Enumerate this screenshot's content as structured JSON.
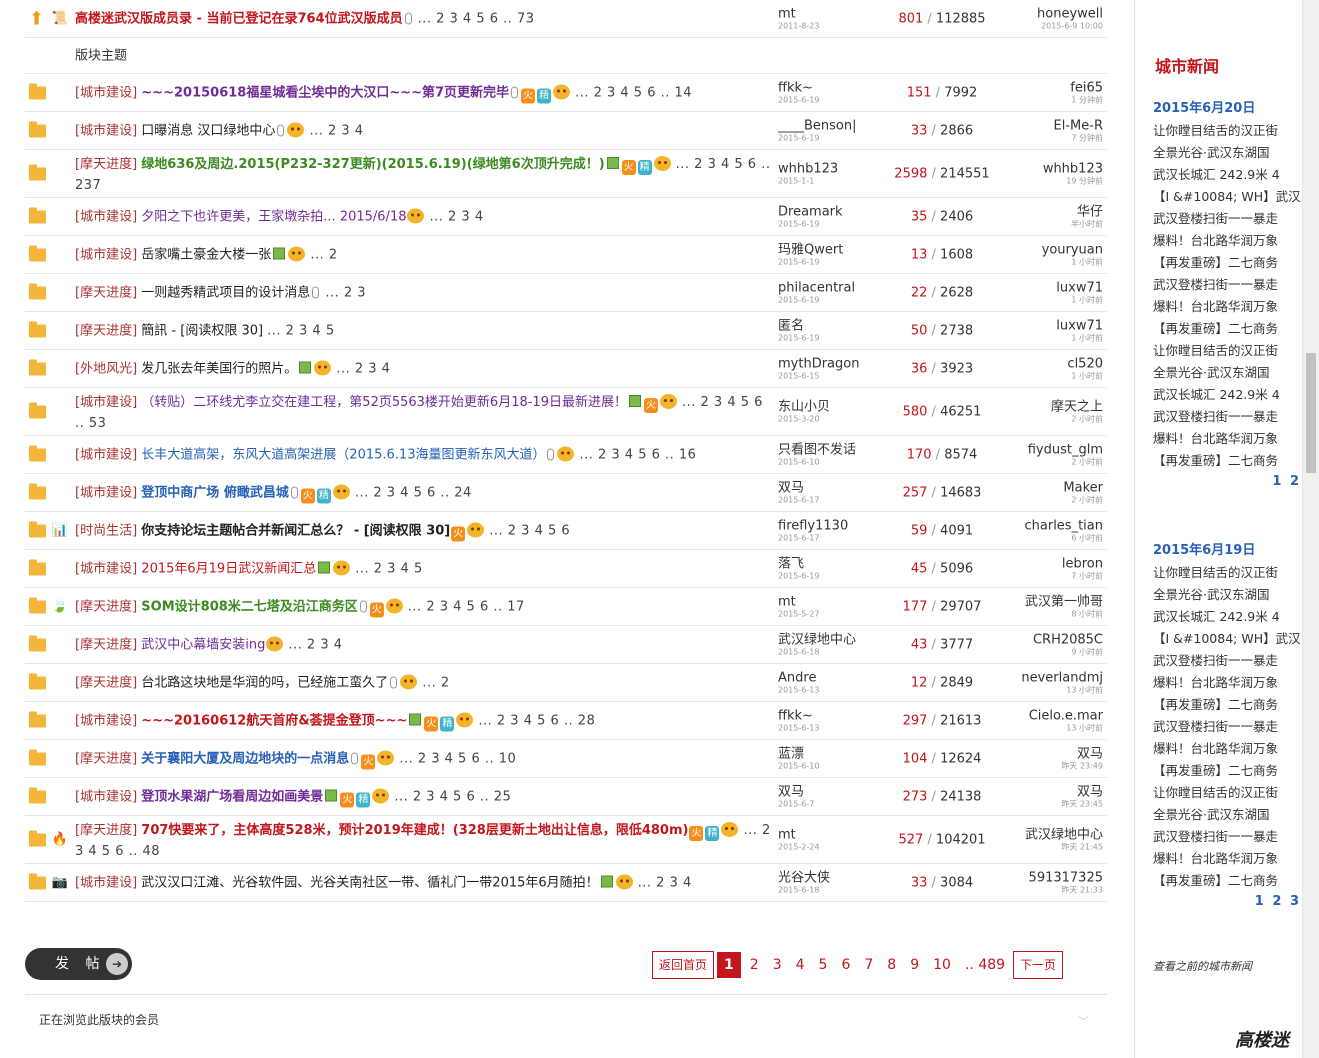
{
  "colors": {
    "accent_red": "#c3161c",
    "link_blue": "#2761b7",
    "folder": "#f5b53b"
  },
  "section_header": "版块主题",
  "threads": [
    {
      "icon2": "note",
      "category": "",
      "title": "高楼迷武汉版成员录 - 当前已登记在录764位武汉版成员",
      "tcls": "t-red b",
      "attach": true,
      "img": false,
      "fire": false,
      "jing": false,
      "smile": false,
      "pages": "... 2 3 4 5 6 .. 73",
      "author": "mt",
      "adate": "2011-8-23",
      "replies": "801",
      "views": "112885",
      "last": "honeywell",
      "ldate": "2015-6-9 10:00",
      "two": false
    },
    {
      "icon2": "",
      "category": "[城市建设]",
      "title": "~~~20150618福星城看尘埃中的大汉口~~~第7页更新完毕",
      "tcls": "t-purple b",
      "attach": true,
      "img": false,
      "fire": true,
      "jing": true,
      "smile": true,
      "pages": "... 2 3 4 5 6 .. 14",
      "author": "ffkk~",
      "adate": "2015-6-19",
      "replies": "151",
      "views": "7992",
      "last": "fei65",
      "ldate": "1 分钟前",
      "two": false
    },
    {
      "icon2": "",
      "category": "[城市建设]",
      "title": "口曝消息 汉口绿地中心",
      "tcls": "t-dark",
      "attach": true,
      "img": false,
      "fire": false,
      "jing": false,
      "smile": true,
      "pages": "... 2 3 4",
      "author": "____Benson|",
      "adate": "2015-6-19",
      "replies": "33",
      "views": "2866",
      "last": "El-Me-R",
      "ldate": "7 分钟前",
      "two": false
    },
    {
      "icon2": "",
      "category": "[摩天进度]",
      "title": "绿地636及周边.2015(P232-327更新)(2015.6.19)(绿地第6次顶升完成！)",
      "tcls": "t-green b",
      "attach": false,
      "img": true,
      "fire": true,
      "jing": true,
      "smile": true,
      "pages": "... 2 3 4 5 6 .. 237",
      "author": "whhb123",
      "adate": "2015-1-1",
      "replies": "2598",
      "views": "214551",
      "last": "whhb123",
      "ldate": "19 分钟前",
      "two": true
    },
    {
      "icon2": "",
      "category": "[城市建设]",
      "title": "夕阳之下也许更美，王家墩杂拍... 2015/6/18",
      "tcls": "t-purple",
      "attach": false,
      "img": false,
      "fire": false,
      "jing": false,
      "smile": true,
      "pages": "... 2 3 4",
      "author": "Dreamark",
      "adate": "2015-6-19",
      "replies": "35",
      "views": "2406",
      "last": "华仔",
      "ldate": "半小时前",
      "two": false
    },
    {
      "icon2": "",
      "category": "[城市建设]",
      "title": "岳家嘴土豪金大楼一张",
      "tcls": "t-dark",
      "attach": false,
      "img": true,
      "fire": false,
      "jing": false,
      "smile": true,
      "pages": "... 2",
      "author": "玛雅Qwert",
      "adate": "2015-6-19",
      "replies": "13",
      "views": "1608",
      "last": "youryuan",
      "ldate": "1 小时前",
      "two": false
    },
    {
      "icon2": "",
      "category": "[摩天进度]",
      "title": "一则越秀精武项目的设计消息",
      "tcls": "t-dark",
      "attach": true,
      "img": false,
      "fire": false,
      "jing": false,
      "smile": false,
      "pages": "... 2 3",
      "author": "philacentral",
      "adate": "2015-6-19",
      "replies": "22",
      "views": "2628",
      "last": "luxw71",
      "ldate": "1 小时前",
      "two": false
    },
    {
      "icon2": "",
      "category": "[摩天进度]",
      "title": "簡訊 - [阅读权限 30]",
      "tcls": "t-dark",
      "attach": false,
      "img": false,
      "fire": false,
      "jing": false,
      "smile": false,
      "pages": "... 2 3 4 5",
      "author": "匿名",
      "adate": "2015-6-19",
      "replies": "50",
      "views": "2738",
      "last": "luxw71",
      "ldate": "1 小时前",
      "two": false
    },
    {
      "icon2": "",
      "category": "[外地风光]",
      "title": "发几张去年美国行的照片。",
      "tcls": "t-dark",
      "attach": false,
      "img": true,
      "fire": false,
      "jing": false,
      "smile": true,
      "pages": "... 2 3 4",
      "author": "mythDragon",
      "adate": "2015-6-15",
      "replies": "36",
      "views": "3923",
      "last": "cl520",
      "ldate": "1 小时前",
      "two": false
    },
    {
      "icon2": "",
      "category": "[城市建设]",
      "title": "（转贴）二环线尤李立交在建工程，第52页5563楼开始更新6月18-19日最新进展！",
      "tcls": "t-purple",
      "attach": false,
      "img": true,
      "fire": true,
      "jing": false,
      "smile": true,
      "pages": "... 2 3 4 5 6 .. 53",
      "author": "东山小贝",
      "adate": "2015-3-20",
      "replies": "580",
      "views": "46251",
      "last": "摩天之上",
      "ldate": "2 小时前",
      "two": true
    },
    {
      "icon2": "",
      "category": "[城市建设]",
      "title": "长丰大道高架，东风大道高架进展（2015.6.13海量图更新东风大道）",
      "tcls": "t-blue",
      "attach": true,
      "img": false,
      "fire": false,
      "jing": false,
      "smile": true,
      "pages": "... 2 3 4 5 6 .. 16",
      "author": "只看图不发话",
      "adate": "2015-6-10",
      "replies": "170",
      "views": "8574",
      "last": "fiydust_glm",
      "ldate": "2 小时前",
      "two": false
    },
    {
      "icon2": "",
      "category": "[城市建设]",
      "title": "登顶中商广场 俯瞰武昌城",
      "tcls": "t-blue b",
      "attach": true,
      "img": false,
      "fire": true,
      "jing": true,
      "smile": true,
      "pages": "... 2 3 4 5 6 .. 24",
      "author": "双马",
      "adate": "2015-6-17",
      "replies": "257",
      "views": "14683",
      "last": "Maker",
      "ldate": "2 小时前",
      "two": false
    },
    {
      "icon2": "bars",
      "category": "[时尚生活]",
      "title": "你支持论坛主题帖合并新闻汇总么？ - [阅读权限 30]",
      "tcls": "t-dark b",
      "attach": false,
      "img": false,
      "fire": true,
      "jing": false,
      "smile": true,
      "pages": "... 2 3 4 5 6",
      "author": "firefly1130",
      "adate": "2015-6-17",
      "replies": "59",
      "views": "4091",
      "last": "charles_tian",
      "ldate": "6 小时前",
      "two": false
    },
    {
      "icon2": "",
      "category": "[城市建设]",
      "title": "2015年6月19日武汉新闻汇总",
      "tcls": "t-red",
      "attach": false,
      "img": true,
      "fire": false,
      "jing": false,
      "smile": true,
      "pages": "... 2 3 4 5",
      "author": "落飞",
      "adate": "2015-6-19",
      "replies": "45",
      "views": "5096",
      "last": "lebron",
      "ldate": "7 小时前",
      "two": false
    },
    {
      "icon2": "leaf",
      "category": "[摩天进度]",
      "title": "SOM设计808米二七塔及沿江商务区",
      "tcls": "t-green b",
      "attach": true,
      "img": false,
      "fire": true,
      "jing": false,
      "smile": true,
      "pages": "... 2 3 4 5 6 .. 17",
      "author": "mt",
      "adate": "2015-5-27",
      "replies": "177",
      "views": "29707",
      "last": "武汉第一帅哥",
      "ldate": "8 小时前",
      "two": false
    },
    {
      "icon2": "",
      "category": "[摩天进度]",
      "title": "武汉中心幕墙安装ing",
      "tcls": "t-purple",
      "attach": false,
      "img": false,
      "fire": false,
      "jing": false,
      "smile": true,
      "pages": "... 2 3 4",
      "author": "武汉绿地中心",
      "adate": "2015-6-18",
      "replies": "43",
      "views": "3777",
      "last": "CRH2085C",
      "ldate": "9 小时前",
      "two": false
    },
    {
      "icon2": "",
      "category": "[摩天进度]",
      "title": "台北路这块地是华润的吗，已经施工蛮久了",
      "tcls": "t-dark",
      "attach": true,
      "img": false,
      "fire": false,
      "jing": false,
      "smile": true,
      "pages": "... 2",
      "author": "Andre",
      "adate": "2015-6-13",
      "replies": "12",
      "views": "2849",
      "last": "neverlandmj",
      "ldate": "13 小时前",
      "two": false
    },
    {
      "icon2": "",
      "category": "[城市建设]",
      "title": "~~~20160612航天首府&荟提金登顶~~~",
      "tcls": "t-red b",
      "attach": false,
      "img": true,
      "fire": true,
      "jing": true,
      "smile": true,
      "pages": "... 2 3 4 5 6 .. 28",
      "author": "ffkk~",
      "adate": "2015-6-13",
      "replies": "297",
      "views": "21613",
      "last": "Cielo.e.mar",
      "ldate": "13 小时前",
      "two": false
    },
    {
      "icon2": "",
      "category": "[摩天进度]",
      "title": "关于襄阳大厦及周边地块的一点消息",
      "tcls": "t-blue b",
      "attach": true,
      "img": false,
      "fire": true,
      "jing": false,
      "smile": true,
      "pages": "... 2 3 4 5 6 .. 10",
      "author": "蓝漂",
      "adate": "2015-6-10",
      "replies": "104",
      "views": "12624",
      "last": "双马",
      "ldate": "昨天 23:49",
      "two": false
    },
    {
      "icon2": "",
      "category": "[城市建设]",
      "title": "登顶水果湖广场看周边如画美景",
      "tcls": "t-purple b",
      "attach": false,
      "img": true,
      "fire": true,
      "jing": true,
      "smile": true,
      "pages": "... 2 3 4 5 6 .. 25",
      "author": "双马",
      "adate": "2015-6-7",
      "replies": "273",
      "views": "24138",
      "last": "双马",
      "ldate": "昨天 23:45",
      "two": false
    },
    {
      "icon2": "flame",
      "category": "[摩天进度]",
      "title": "707快要来了，主体高度528米，预计2019年建成！(328层更新土地出让信息，限低480m)",
      "tcls": "t-red b",
      "attach": false,
      "img": false,
      "fire": true,
      "jing": true,
      "smile": true,
      "pages": "... 2 3 4 5 6 .. 48",
      "author": "mt",
      "adate": "2015-2-24",
      "replies": "527",
      "views": "104201",
      "last": "武汉绿地中心",
      "ldate": "昨天 21:45",
      "two": true
    },
    {
      "icon2": "camera",
      "category": "[城市建设]",
      "title": "武汉汉口江滩、光谷软件园、光谷关南社区一带、循礼门一带2015年6月随拍！",
      "tcls": "t-dark",
      "attach": false,
      "img": true,
      "fire": false,
      "jing": false,
      "smile": true,
      "pages": "... 2 3 4",
      "author": "光谷大侠",
      "adate": "2015-6-18",
      "replies": "33",
      "views": "3084",
      "last": "591317325",
      "ldate": "昨天 21:33",
      "two": false
    }
  ],
  "post_button": "发 帖",
  "pager": {
    "back": "返回首页",
    "pages": [
      "1",
      "2",
      "3",
      "4",
      "5",
      "6",
      "7",
      "8",
      "9",
      "10",
      ".. 489"
    ],
    "next": "下一页"
  },
  "browsing_label": "正在浏览此版块的会员",
  "sidebar": {
    "title": "城市新闻",
    "blocks": [
      {
        "date": "2015年6月20日",
        "items": [
          "让你瞠目结舌的汉正街",
          "全景光谷·武汉东湖国",
          "武汉长城汇 242.9米 4",
          "【I &#10084; WH】武汉",
          "武汉登楼扫街一一暴走",
          "爆料！台北路华润万象",
          "【再发重磅】二七商务",
          "武汉登楼扫街一一暴走",
          "爆料！台北路华润万象",
          "【再发重磅】二七商务",
          "让你瞠目结舌的汉正街",
          "全景光谷·武汉东湖国",
          "武汉长城汇 242.9米 4",
          "武汉登楼扫街一一暴走",
          "爆料！台北路华润万象",
          "【再发重磅】二七商务"
        ],
        "pages": "1 2"
      },
      {
        "date": "2015年6月19日",
        "items": [
          "让你瞠目结舌的汉正街",
          "全景光谷·武汉东湖国",
          "武汉长城汇 242.9米 4",
          "【I &#10084; WH】武汉",
          "武汉登楼扫街一一暴走",
          "爆料！台北路华润万象",
          "【再发重磅】二七商务",
          "武汉登楼扫街一一暴走",
          "爆料！台北路华润万象",
          "【再发重磅】二七商务",
          "让你瞠目结舌的汉正街",
          "全景光谷·武汉东湖国",
          "武汉登楼扫街一一暴走",
          "爆料！台北路华润万象",
          "【再发重磅】二七商务"
        ],
        "pages": "1 2 3"
      }
    ],
    "older_link": "查看之前的城市新闻",
    "logo": "高楼迷"
  }
}
